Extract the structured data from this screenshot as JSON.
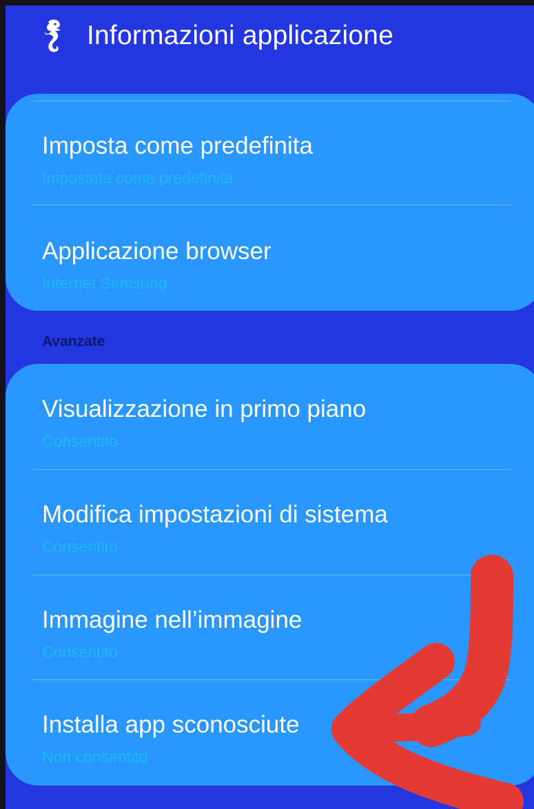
{
  "header": {
    "icon": "seahorse-icon",
    "title": "Informazioni applicazione"
  },
  "defaults_group": {
    "items": [
      {
        "title": "Imposta come predefinita",
        "subtitle": "Impostata come predefinita"
      },
      {
        "title": "Applicazione browser",
        "subtitle": "Internet Samsung"
      }
    ]
  },
  "advanced_section": {
    "label": "Avanzate",
    "items": [
      {
        "title": "Visualizzazione in primo piano",
        "subtitle": "Consentito"
      },
      {
        "title": "Modifica impostazioni di sistema",
        "subtitle": "Consentito"
      },
      {
        "title": "Immagine nell’immagine",
        "subtitle": "Consentito"
      },
      {
        "title": "Installa app sconosciute",
        "subtitle": "Non consentito"
      }
    ]
  },
  "colors": {
    "background": "#2436e0",
    "card": "#2997ff",
    "subtitle": "#19b9f5",
    "section_label": "#0b1a6e",
    "annotation_arrow": "#e43a36"
  }
}
